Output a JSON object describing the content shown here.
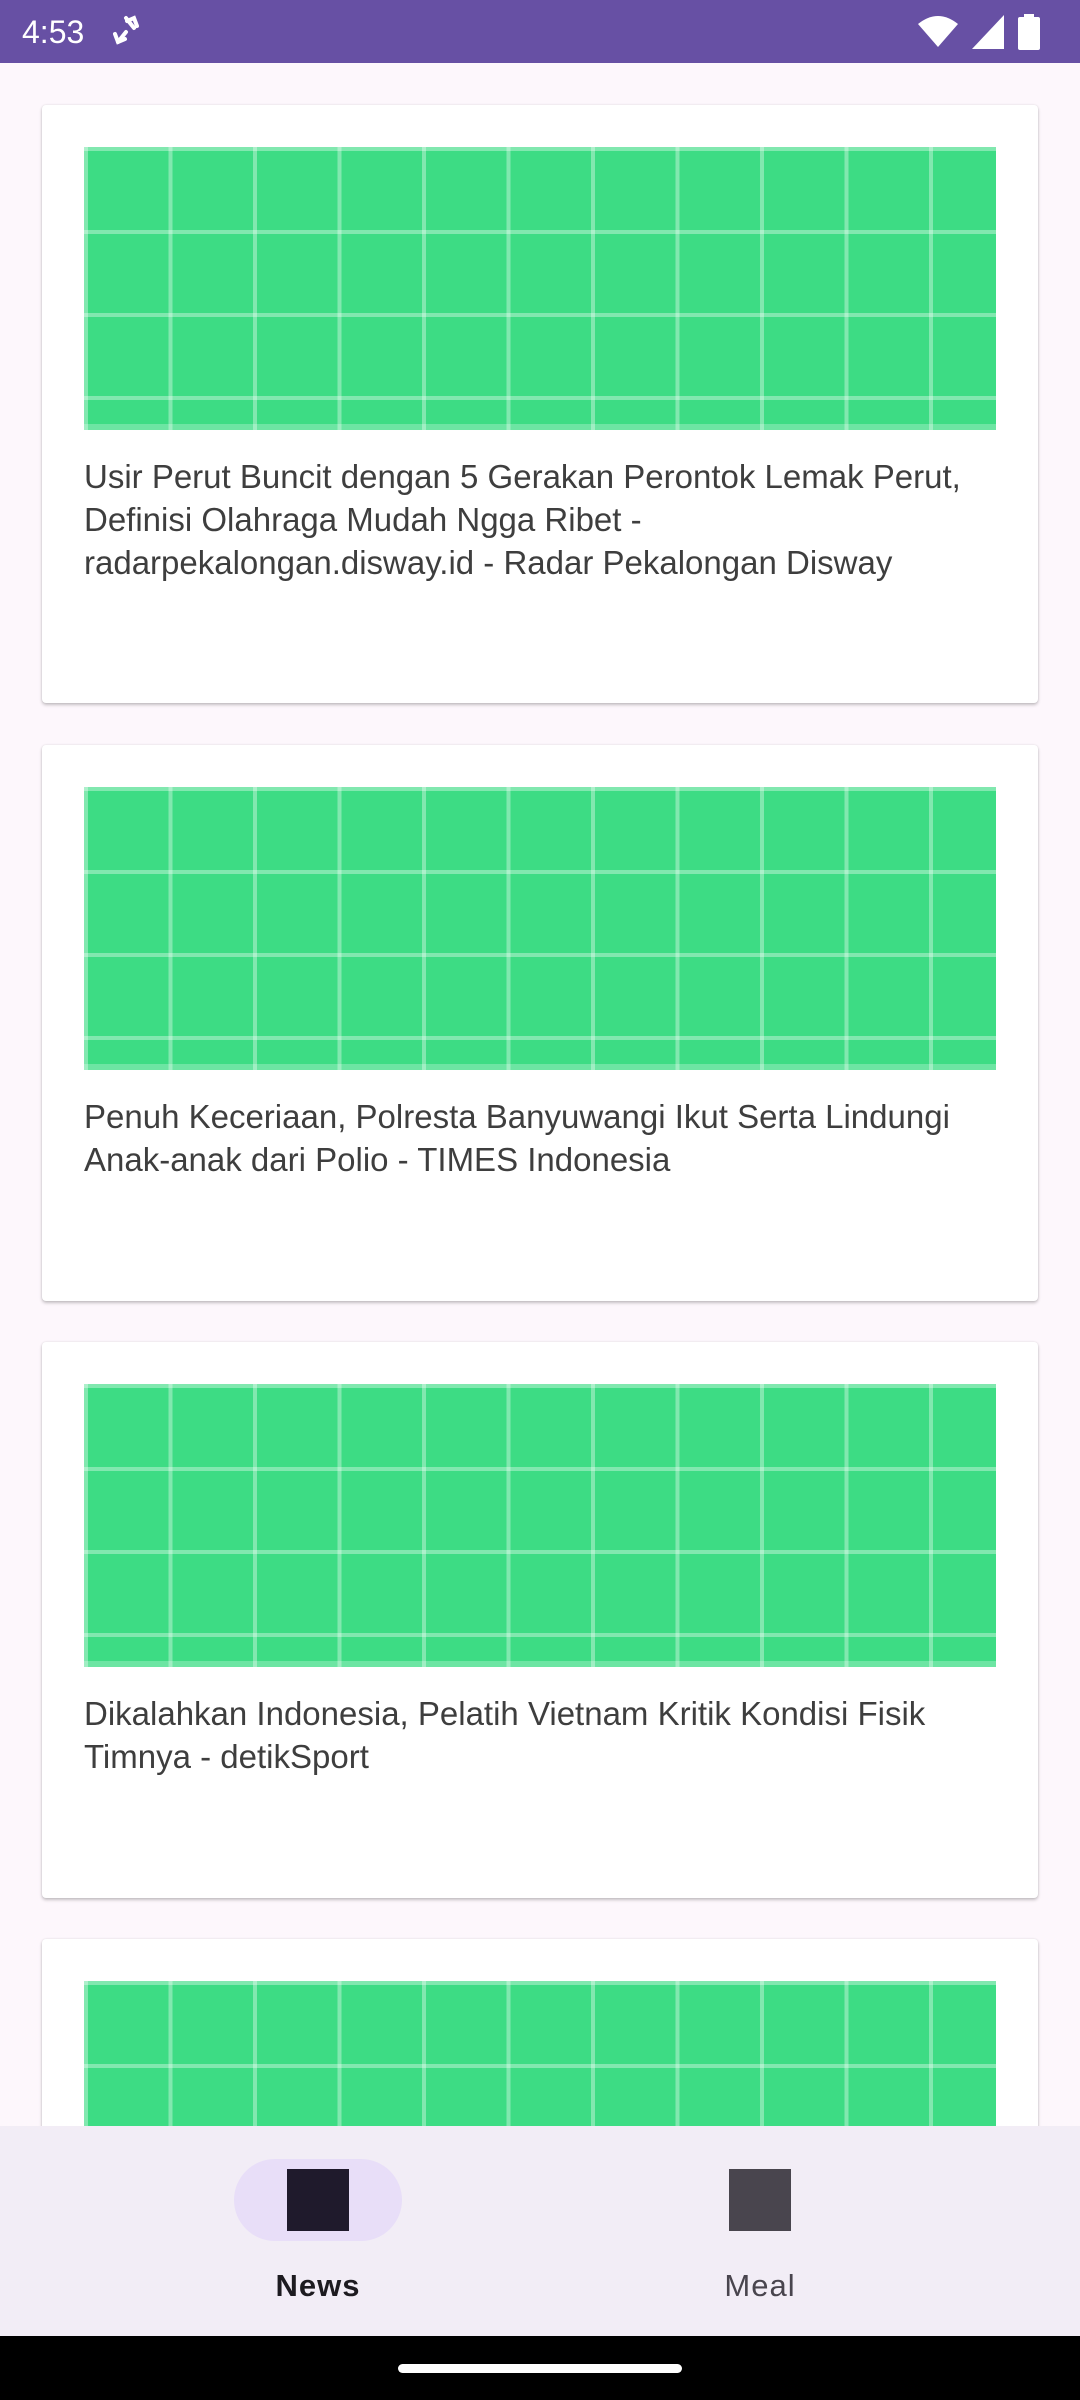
{
  "status_bar": {
    "time": "4:53",
    "icons": [
      "sync-icon",
      "wifi-icon",
      "signal-icon",
      "battery-icon"
    ],
    "background": "#6750a4"
  },
  "feed": {
    "items": [
      {
        "title": "Usir Perut Buncit dengan 5 Gerakan Perontok Lemak Perut, Definisi Olahraga Mudah Ngga Ribet - radarpekalongan.disway.id - Radar Pekalongan Disway"
      },
      {
        "title": "Penuh Keceriaan, Polresta Banyuwangi Ikut Serta Lindungi Anak-anak dari Polio - TIMES Indonesia"
      },
      {
        "title": "Dikalahkan Indonesia, Pelatih Vietnam Kritik Kondisi Fisik Timnya - detikSport"
      },
      {
        "title": ""
      }
    ],
    "image_color": "#3ddc84"
  },
  "bottom_nav": {
    "items": [
      {
        "label": "News",
        "icon": "news-icon",
        "selected": true
      },
      {
        "label": "Meal",
        "icon": "meal-icon",
        "selected": false
      }
    ]
  }
}
